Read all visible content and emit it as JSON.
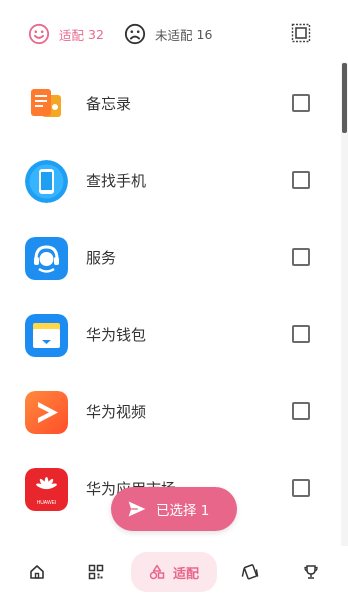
{
  "filters": {
    "adapted": {
      "label": "适配",
      "count": "32",
      "icon": "smile-icon",
      "color": "#e86a8e"
    },
    "unadapted": {
      "label": "未适配",
      "count": "16",
      "icon": "frown-icon"
    }
  },
  "apps": [
    {
      "name": "备忘录",
      "icon": "memo-app-icon",
      "checked": false
    },
    {
      "name": "查找手机",
      "icon": "find-phone-app-icon",
      "checked": false
    },
    {
      "name": "服务",
      "icon": "service-app-icon",
      "checked": false
    },
    {
      "name": "华为钱包",
      "icon": "wallet-app-icon",
      "checked": false
    },
    {
      "name": "华为视频",
      "icon": "video-app-icon",
      "checked": false
    },
    {
      "name": "华为应用市场",
      "icon": "appgallery-app-icon",
      "checked": false
    }
  ],
  "appgallery_logo_text": "HUAWEI",
  "fab": {
    "label": "已选择 1",
    "icon": "send-icon",
    "color": "#e9668b"
  },
  "bottom_nav": {
    "items": [
      {
        "id": "home",
        "icon": "home-icon"
      },
      {
        "id": "grid",
        "icon": "grid-icon"
      },
      {
        "id": "adapt",
        "icon": "shapes-icon",
        "label": "适配",
        "active": true
      },
      {
        "id": "cards",
        "icon": "cards-icon"
      },
      {
        "id": "trophy",
        "icon": "trophy-icon"
      }
    ]
  }
}
